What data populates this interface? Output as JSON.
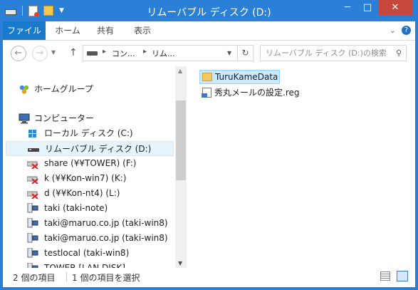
{
  "titlebar": {
    "title": "リムーバブル ディスク (D:)",
    "minimize": "─",
    "maximize": "□",
    "close": "✕"
  },
  "ribbon": {
    "tabs": [
      "ファイル",
      "ホーム",
      "共有",
      "表示"
    ]
  },
  "address": {
    "crumbs": [
      "コン...",
      "リム..."
    ],
    "search_placeholder": "リムーバブル ディスク (D:)の検索"
  },
  "nav": {
    "homegroup": "ホームグループ",
    "computer": "コンピューター",
    "drives": [
      {
        "label": "ローカル ディスク (C:)",
        "icon": "windows-drive-icon"
      },
      {
        "label": "リムーバブル ディスク (D:)",
        "icon": "removable-drive-icon",
        "selected": true
      },
      {
        "label": "share (¥¥TOWER) (F:)",
        "icon": "network-drive-disconnected-icon"
      },
      {
        "label": "k (¥¥Kon-win7) (K:)",
        "icon": "network-drive-disconnected-icon"
      },
      {
        "label": "d (¥¥Kon-nt4) (L:)",
        "icon": "network-drive-disconnected-icon"
      },
      {
        "label": "taki (taki-note)",
        "icon": "network-computer-icon"
      },
      {
        "label": "taki@maruo.co.jp (taki-win8)",
        "icon": "network-computer-icon"
      },
      {
        "label": "taki@maruo.co.jp (taki-win8)",
        "icon": "network-computer-icon"
      },
      {
        "label": "testlocal (taki-win8)",
        "icon": "network-computer-icon"
      },
      {
        "label": "TOWER [LAN DISK]",
        "icon": "network-computer-icon"
      }
    ]
  },
  "content": {
    "items": [
      {
        "name": "TuruKameData",
        "icon": "folder-icon",
        "selected": true
      },
      {
        "name": "秀丸メールの設定.reg",
        "icon": "registry-file-icon"
      }
    ]
  },
  "status": {
    "count": "2 個の項目",
    "selected": "1 個の項目を選択"
  }
}
